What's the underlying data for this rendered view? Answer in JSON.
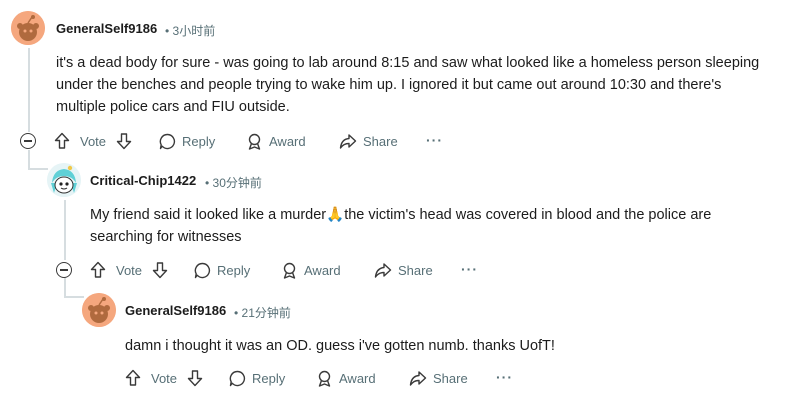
{
  "comments": [
    {
      "username": "GeneralSelf9186",
      "time": "3小时前",
      "body_lines": [
        "it's a dead body for sure - was going to lab around 8:15 and saw what looked like a homeless person sleeping",
        "under the benches and people trying to wake him up. I ignored it but came out around 10:30 and there's",
        "multiple police cars and FIU outside."
      ]
    },
    {
      "username": "Critical-Chip1422",
      "time": "30分钟前",
      "body_lines": [
        "My friend said it looked like a murder",
        "the victim's head was covered in blood and the police are",
        "searching for witnesses"
      ],
      "emoji": "🙏"
    },
    {
      "username": "GeneralSelf9186",
      "time": "21分钟前",
      "body_lines": [
        "damn i thought it was an OD. guess i've gotten numb. thanks UofT!"
      ]
    }
  ],
  "actions": {
    "vote": "Vote",
    "reply": "Reply",
    "award": "Award",
    "share": "Share",
    "more": "···"
  },
  "meta_separator": "•",
  "colors": {
    "avatar_orange": "#f5a77e",
    "avatar_snoo": "#b06a3e",
    "muted": "#576f76",
    "thread_line": "#d6dde0"
  },
  "icons": [
    "snoo-avatar-icon",
    "upvote-arrow-icon",
    "downvote-arrow-icon",
    "comment-bubble-icon",
    "award-icon",
    "share-arrow-icon",
    "collapse-minus-icon",
    "more-dots-icon"
  ]
}
